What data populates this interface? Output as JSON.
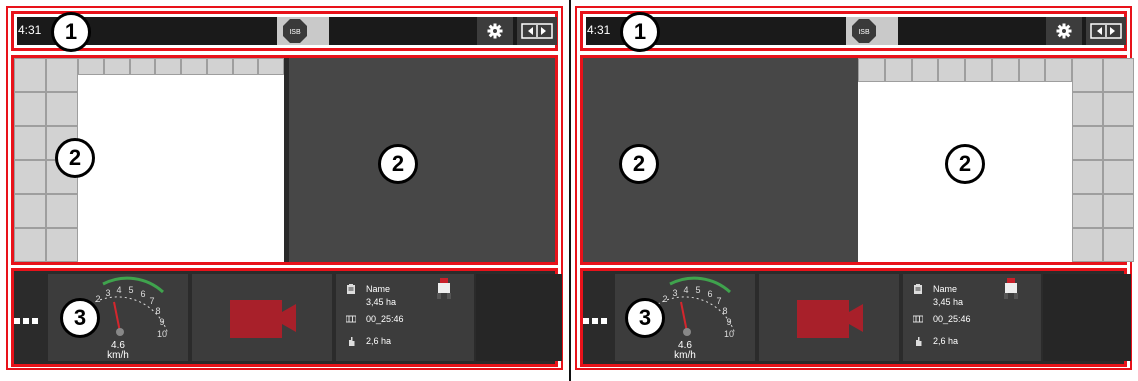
{
  "left_panel": {
    "statusbar": {
      "time": "4:31",
      "isb_label": "ISB"
    },
    "badges": {
      "top": "1",
      "middle_a": "2",
      "middle_b": "2",
      "bottom": "3"
    },
    "speedometer": {
      "ticks": [
        "2",
        "3",
        "4",
        "5",
        "6",
        "7",
        "8",
        "9",
        "10"
      ],
      "speed": "4.6",
      "unit": "km/h"
    },
    "info": {
      "name": "Name",
      "area1": "3,45 ha",
      "time": "00_25:46",
      "area2": "2,6 ha"
    }
  },
  "right_panel": {
    "statusbar": {
      "time": "4:31",
      "isb_label": "ISB"
    },
    "badges": {
      "top": "1",
      "middle_a": "2",
      "middle_b": "2",
      "bottom": "3"
    },
    "speedometer": {
      "ticks": [
        "2",
        "3",
        "4",
        "5",
        "6",
        "7",
        "8",
        "9",
        "10"
      ],
      "speed": "4.6",
      "unit": "km/h"
    },
    "info": {
      "name": "Name",
      "area1": "3,45 ha",
      "time": "00_25:46",
      "area2": "2,6 ha"
    }
  },
  "icons": [
    "gear-icon",
    "swap-screens-icon",
    "isb-icon",
    "more-dots-icon",
    "camera-icon",
    "tractor-icon",
    "clipboard-icon",
    "counter-icon",
    "hand-icon"
  ],
  "colors": {
    "highlight_red": "#e8121a",
    "camera_red": "#a8202a",
    "gauge_green": "#3fa34d",
    "needle_red": "#d4262d",
    "dark_bg": "#1a1a1a",
    "tile_bg": "#3c3c3c"
  }
}
